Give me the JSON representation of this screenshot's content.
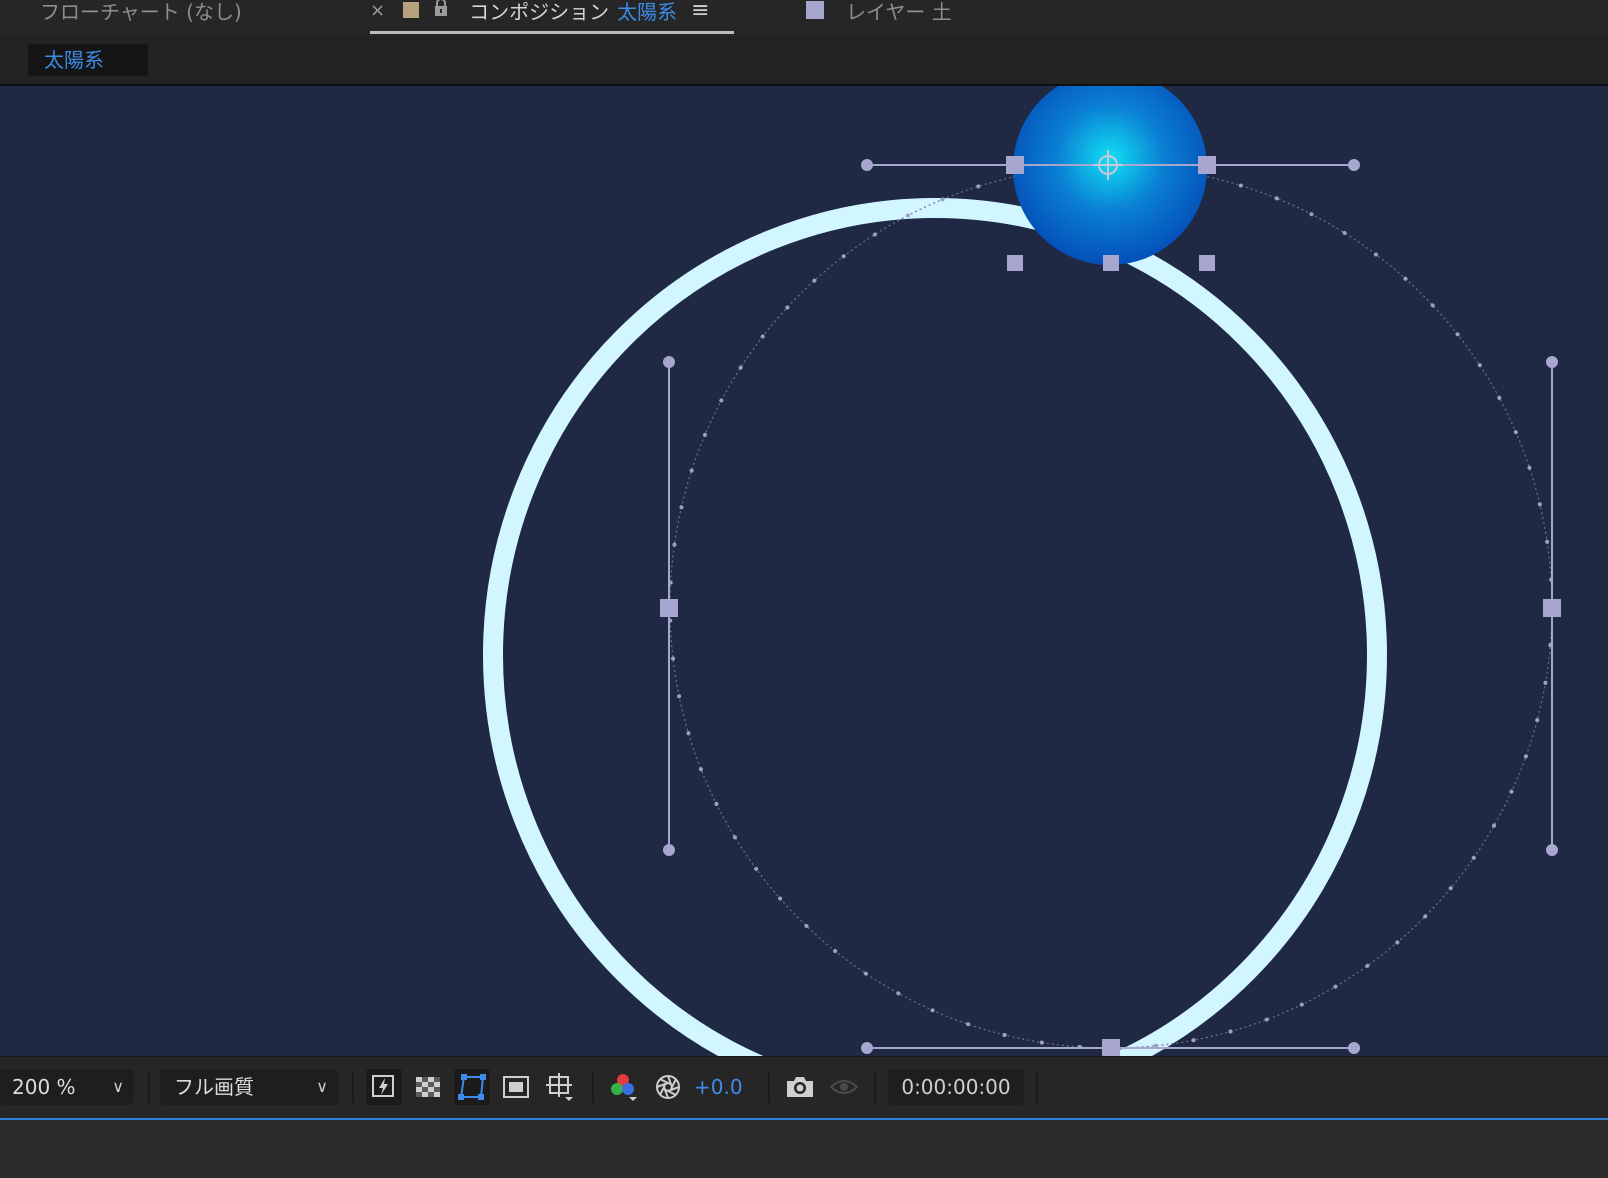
{
  "tabs": {
    "flowchart": "フローチャート (なし)",
    "close": "×",
    "composition_prefix": "コンポジション",
    "composition_name": "太陽系",
    "menu": "≡",
    "layer": "レイヤー 土"
  },
  "breadcrumb": {
    "label": "太陽系"
  },
  "toolbar": {
    "zoom": "200 %",
    "quality": "フル画質",
    "exposure": "+0.0",
    "timecode": "0:00:00:00"
  },
  "colors": {
    "viewer_background": "#1f2944",
    "accent_blue": "#3e8be8",
    "ring": "#d2f6ff",
    "handle": "#a7a6cf",
    "comp_swatch": "#b7a27d",
    "layer_swatch": "#a7a6cf"
  },
  "icons": [
    "fast-preview-icon",
    "transparency-grid-icon",
    "mask-path-icon",
    "region-of-interest-icon",
    "guides-icon",
    "color-channels-icon",
    "exposure-icon",
    "snapshot-icon",
    "show-snapshot-icon",
    "lock-icon"
  ]
}
